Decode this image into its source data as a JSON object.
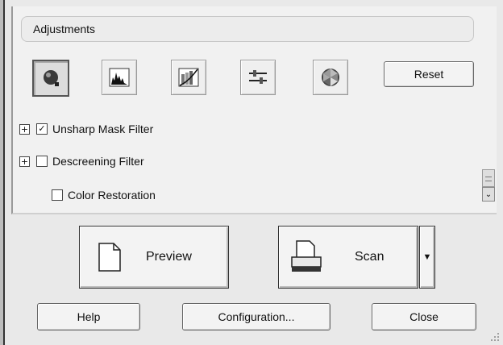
{
  "adjustments": {
    "title": "Adjustments",
    "tools": [
      {
        "name": "auto-exposure-icon"
      },
      {
        "name": "histogram-icon"
      },
      {
        "name": "tone-curve-icon"
      },
      {
        "name": "image-adjustment-icon"
      },
      {
        "name": "color-palette-icon"
      }
    ],
    "reset_label": "Reset"
  },
  "options": [
    {
      "label": "Unsharp Mask Filter",
      "checked": true,
      "expandable": true
    },
    {
      "label": "Descreening Filter",
      "checked": false,
      "expandable": true
    },
    {
      "label": "Color Restoration",
      "checked": false,
      "expandable": false
    }
  ],
  "actions": {
    "preview_label": "Preview",
    "scan_label": "Scan"
  },
  "footer": {
    "help_label": "Help",
    "configuration_label": "Configuration...",
    "close_label": "Close"
  }
}
